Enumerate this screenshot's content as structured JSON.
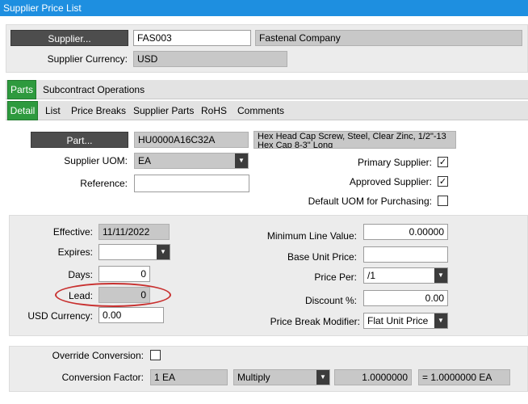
{
  "window": {
    "title": "Supplier Price List"
  },
  "supplier": {
    "button_label": "Supplier...",
    "code": "FAS003",
    "name": "Fastenal Company",
    "currency_label": "Supplier Currency:",
    "currency": "USD"
  },
  "main_tabs": [
    {
      "label": "Parts",
      "active": true
    },
    {
      "label": "Subcontract Operations",
      "active": false
    }
  ],
  "sub_tabs": [
    {
      "label": "Detail",
      "active": true
    },
    {
      "label": "List",
      "active": false
    },
    {
      "label": "Price Breaks",
      "active": false
    },
    {
      "label": "Supplier Parts",
      "active": false
    },
    {
      "label": "RoHS",
      "active": false
    },
    {
      "label": "Comments",
      "active": false
    }
  ],
  "part": {
    "button_label": "Part...",
    "number": "HU0000A16C32A",
    "description": "Hex Head Cap Screw, Steel, Clear Zinc, 1/2\"-13 Hex Cap 8-3\" Long",
    "uom_label": "Supplier UOM:",
    "uom": "EA",
    "reference_label": "Reference:",
    "reference": "",
    "primary_supplier_label": "Primary Supplier:",
    "primary_supplier": true,
    "approved_supplier_label": "Approved Supplier:",
    "approved_supplier": true,
    "default_uom_label": "Default UOM for Purchasing:",
    "default_uom": false
  },
  "pricing": {
    "effective_label": "Effective:",
    "effective": "11/11/2022",
    "expires_label": "Expires:",
    "expires": "",
    "days_label": "Days:",
    "days": "0",
    "lead_label": "Lead:",
    "lead": "0",
    "usd_currency_label": "USD Currency:",
    "usd_currency": "0.00",
    "min_line_value_label": "Minimum Line Value:",
    "min_line_value": "0.00000",
    "base_unit_price_label": "Base Unit Price:",
    "base_unit_price": "",
    "price_per_label": "Price Per:",
    "price_per": "/1",
    "discount_label": "Discount %:",
    "discount": "0.00",
    "price_break_modifier_label": "Price Break Modifier:",
    "price_break_modifier": "Flat Unit Price"
  },
  "conversion": {
    "override_label": "Override Conversion:",
    "override": false,
    "factor_label": "Conversion Factor:",
    "from": "1 EA",
    "operation": "Multiply",
    "factor": "1.0000000",
    "result": "= 1.0000000 EA"
  },
  "icons": {
    "dropdown": "chevron-down-icon",
    "check": "checkmark-icon"
  },
  "colors": {
    "title_bar": "#1e8fe0",
    "active_tab": "#2e9a3e",
    "highlight": "#c8302f"
  }
}
